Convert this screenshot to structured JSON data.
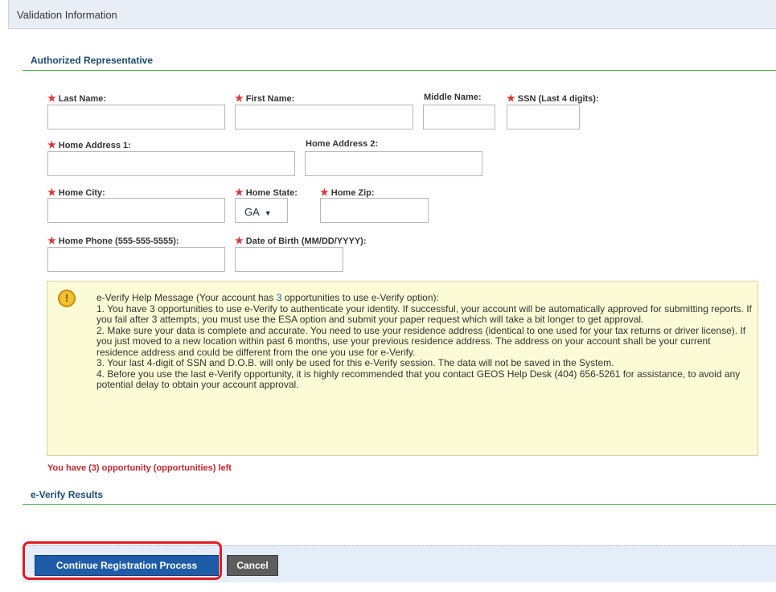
{
  "header": {
    "title": "Validation Information"
  },
  "authorized_section": {
    "title": "Authorized Representative"
  },
  "fields": {
    "last_name": {
      "label": "Last Name:",
      "value": ""
    },
    "first_name": {
      "label": "First Name:",
      "value": ""
    },
    "middle_name": {
      "label": "Middle Name:",
      "value": ""
    },
    "ssn_last4": {
      "label": "SSN (Last 4 digits):",
      "value": ""
    },
    "home_address1": {
      "label": "Home Address 1:",
      "value": ""
    },
    "home_address2": {
      "label": "Home Address 2:",
      "value": ""
    },
    "home_city": {
      "label": "Home City:",
      "value": ""
    },
    "home_state": {
      "label": "Home State:",
      "value": "GA"
    },
    "home_zip": {
      "label": "Home Zip:",
      "value": ""
    },
    "home_phone": {
      "label": "Home Phone (555-555-5555):",
      "value": ""
    },
    "dob": {
      "label": "Date of Birth (MM/DD/YYYY):",
      "value": ""
    }
  },
  "help": {
    "intro_prefix": "e-Verify Help Message (Your account has ",
    "opportunities": "3",
    "intro_suffix": " opportunities to use e-Verify option):",
    "items": [
      "1. You have 3 opportunities to use e-Verify to authenticate your identity. If successful, your account will be automatically approved for submitting reports. If you fail after 3 attempts, you must use the ESA option and submit your paper request which will take a bit longer to get approval.",
      "2. Make sure your data is complete and accurate. You need to use your residence address (identical to one used for your tax returns or driver license). If you just moved to a new location within past 6 months, use your previous residence address. The address on your account shall be your current residence address and could be different from the one you use for e-Verify.",
      "3. Your last 4-digit of SSN and D.O.B. will only be used for this e-Verify session. The data will not be saved in the System.",
      "4. Before you use the last e-Verify opportunity, it is highly recommended that you contact GEOS Help Desk (404) 656-5261 for assistance, to avoid any potential delay to obtain your account approval."
    ]
  },
  "remaining_message": "You have (3) opportunity (opportunities) left",
  "results_section": {
    "title": "e-Verify Results"
  },
  "buttons": {
    "continue": "Continue Registration Process",
    "cancel": "Cancel"
  },
  "icons": {
    "required": "required-asterisk-icon",
    "warning": "warning-icon",
    "caret": "caret-down-icon"
  },
  "colors": {
    "accent_green": "#4caf50",
    "title_blue": "#1b4a73",
    "primary_button": "#1e5ca8",
    "highlight_red": "#e01b24",
    "warning_text": "#c4262e"
  }
}
